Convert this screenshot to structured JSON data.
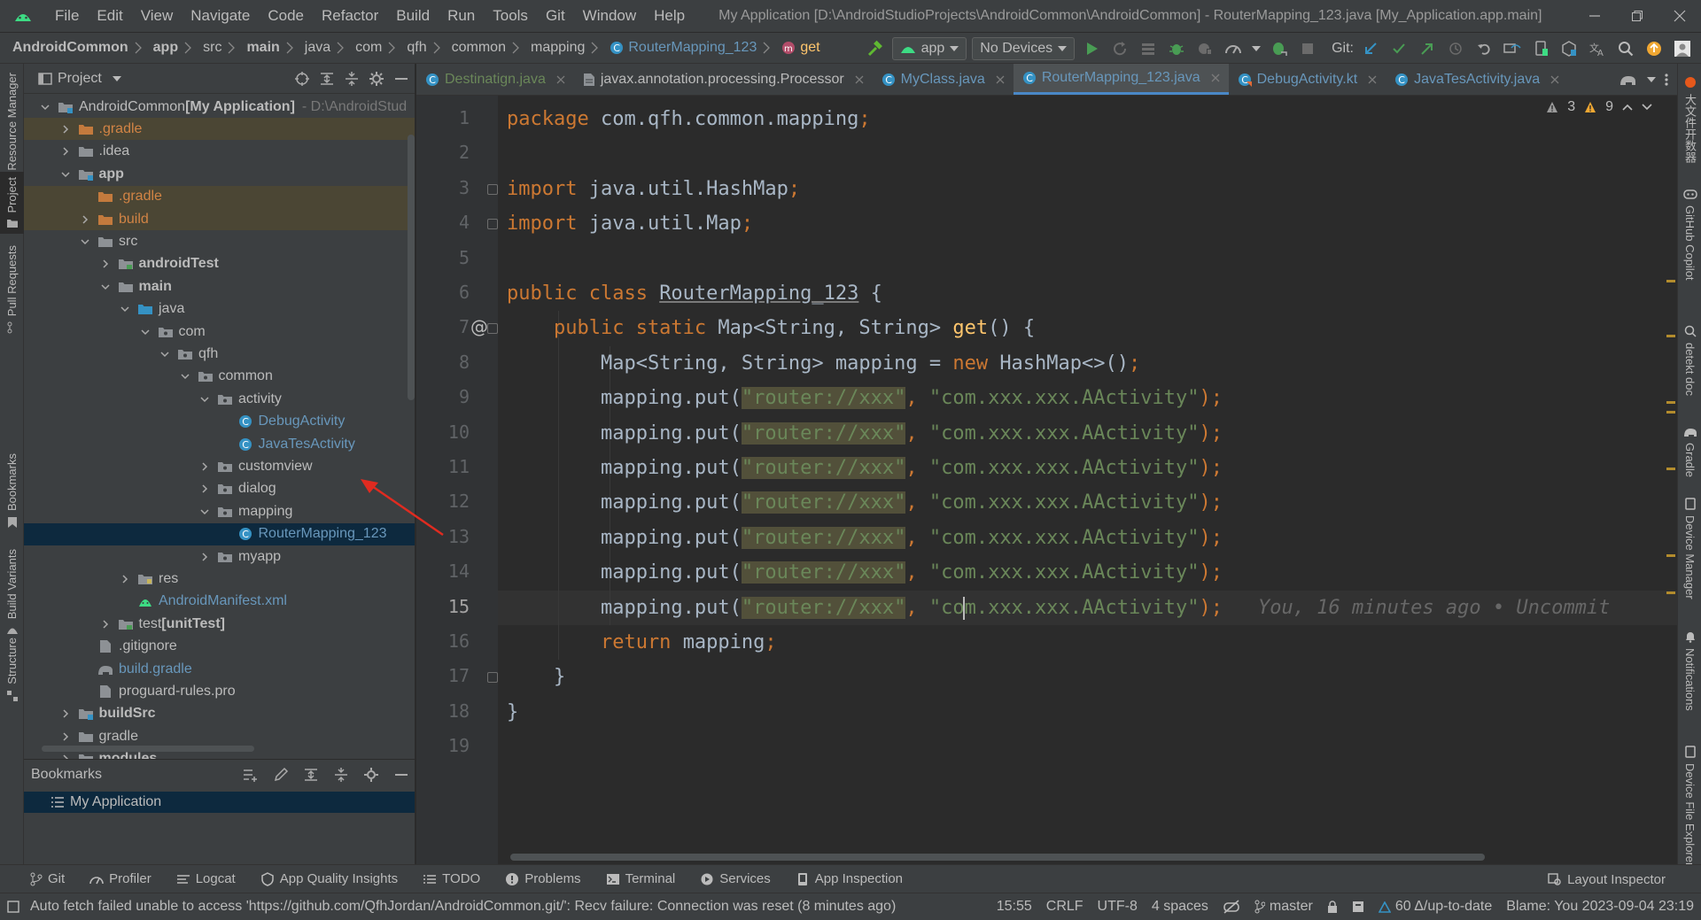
{
  "menu": [
    "File",
    "Edit",
    "View",
    "Navigate",
    "Code",
    "Refactor",
    "Build",
    "Run",
    "Tools",
    "Git",
    "Window",
    "Help"
  ],
  "window_title": "My Application [D:\\AndroidStudioProjects\\AndroidCommon\\AndroidCommon] - RouterMapping_123.java [My_Application.app.main]",
  "breadcrumbs": [
    "AndroidCommon",
    "app",
    "src",
    "main",
    "java",
    "com",
    "qfh",
    "common",
    "mapping",
    "RouterMapping_123",
    "get"
  ],
  "toolbar": {
    "run_config": "app",
    "device": "No Devices",
    "git_label": "Git:"
  },
  "left_strip": [
    "Resource Manager",
    "Project",
    "Pull Requests",
    "Bookmarks",
    "Build Variants",
    "Structure"
  ],
  "right_strip": [
    "大文件开数器",
    "GitHub Copilot",
    "detekt doc",
    "Gradle",
    "Device Manager",
    "Notifications",
    "Device File Explorer"
  ],
  "project": {
    "title": "Project",
    "tree": [
      {
        "label": "AndroidCommon",
        "suffix": " [My Application]",
        "path": " - D:\\AndroidStud",
        "depth": 0,
        "arrow": "down",
        "icon": "module",
        "style": "root"
      },
      {
        "label": ".gradle",
        "depth": 1,
        "arrow": "right",
        "icon": "folder-orange",
        "style": "orange",
        "excluded": true
      },
      {
        "label": ".idea",
        "depth": 1,
        "arrow": "right",
        "icon": "folder",
        "style": "plain"
      },
      {
        "label": "app",
        "depth": 1,
        "arrow": "down",
        "icon": "module",
        "style": "bold"
      },
      {
        "label": ".gradle",
        "depth": 2,
        "arrow": "",
        "icon": "folder-orange",
        "style": "orange",
        "excluded": true
      },
      {
        "label": "build",
        "depth": 2,
        "arrow": "right",
        "icon": "folder-orange",
        "style": "orange",
        "excluded": true
      },
      {
        "label": "src",
        "depth": 2,
        "arrow": "down",
        "icon": "folder",
        "style": "plain"
      },
      {
        "label": "androidTest",
        "depth": 3,
        "arrow": "right",
        "icon": "folder-test",
        "style": "bold"
      },
      {
        "label": "main",
        "depth": 3,
        "arrow": "down",
        "icon": "folder",
        "style": "bold"
      },
      {
        "label": "java",
        "depth": 4,
        "arrow": "down",
        "icon": "folder-src",
        "style": "plain"
      },
      {
        "label": "com",
        "depth": 5,
        "arrow": "down",
        "icon": "package",
        "style": "plain"
      },
      {
        "label": "qfh",
        "depth": 6,
        "arrow": "down",
        "icon": "package",
        "style": "plain"
      },
      {
        "label": "common",
        "depth": 7,
        "arrow": "down",
        "icon": "package",
        "style": "plain"
      },
      {
        "label": "activity",
        "depth": 8,
        "arrow": "down",
        "icon": "package",
        "style": "plain"
      },
      {
        "label": "DebugActivity",
        "depth": 9,
        "arrow": "",
        "icon": "class",
        "style": "blue"
      },
      {
        "label": "JavaTesActivity",
        "depth": 9,
        "arrow": "",
        "icon": "class",
        "style": "blue"
      },
      {
        "label": "customview",
        "depth": 8,
        "arrow": "right",
        "icon": "package",
        "style": "plain"
      },
      {
        "label": "dialog",
        "depth": 8,
        "arrow": "right",
        "icon": "package",
        "style": "plain"
      },
      {
        "label": "mapping",
        "depth": 8,
        "arrow": "down",
        "icon": "package",
        "style": "plain"
      },
      {
        "label": "RouterMapping_123",
        "depth": 9,
        "arrow": "",
        "icon": "class",
        "style": "blue",
        "selected": true
      },
      {
        "label": "myapp",
        "depth": 8,
        "arrow": "right",
        "icon": "package",
        "style": "plain"
      },
      {
        "label": "res",
        "depth": 4,
        "arrow": "right",
        "icon": "folder-res",
        "style": "plain"
      },
      {
        "label": "AndroidManifest.xml",
        "depth": 4,
        "arrow": "",
        "icon": "xml",
        "style": "blue"
      },
      {
        "label": "test",
        "suffix": " [unitTest]",
        "depth": 3,
        "arrow": "right",
        "icon": "folder-test",
        "style": "plain"
      },
      {
        "label": ".gitignore",
        "depth": 2,
        "arrow": "",
        "icon": "file",
        "style": "plain"
      },
      {
        "label": "build.gradle",
        "depth": 2,
        "arrow": "",
        "icon": "gradle",
        "style": "blue"
      },
      {
        "label": "proguard-rules.pro",
        "depth": 2,
        "arrow": "",
        "icon": "file",
        "style": "plain"
      },
      {
        "label": "buildSrc",
        "depth": 1,
        "arrow": "right",
        "icon": "module",
        "style": "bold"
      },
      {
        "label": "gradle",
        "depth": 1,
        "arrow": "right",
        "icon": "folder",
        "style": "plain"
      },
      {
        "label": "modules",
        "depth": 1,
        "arrow": "right",
        "icon": "folder",
        "style": "bold"
      }
    ]
  },
  "bookmarks": {
    "title": "Bookmarks",
    "item": "My Application"
  },
  "tabs": [
    {
      "label": "Destinatign.java",
      "icon": "java-class",
      "color": "#6a8759"
    },
    {
      "label": "javax.annotation.processing.Processor",
      "icon": "text-file",
      "color": "#bbbbbb"
    },
    {
      "label": "MyClass.java",
      "icon": "java-class",
      "color": "#6897bb"
    },
    {
      "label": "RouterMapping_123.java",
      "icon": "java-class",
      "color": "#6897bb",
      "active": true
    },
    {
      "label": "DebugActivity.kt",
      "icon": "kotlin-class",
      "color": "#6897bb"
    },
    {
      "label": "JavaTesActivity.java",
      "icon": "java-class",
      "color": "#6897bb"
    }
  ],
  "editor": {
    "inspections": {
      "warn_a": "3",
      "warn_b": "9"
    },
    "current_line": 15,
    "blame_inline": "You, 16 minutes ago • Uncommit",
    "line_numbers": [
      "1",
      "2",
      "3",
      "4",
      "5",
      "6",
      "7",
      "8",
      "9",
      "10",
      "11",
      "12",
      "13",
      "14",
      "15",
      "16",
      "17",
      "18",
      "19"
    ],
    "lines": [
      [
        {
          "t": "package ",
          "c": "kw"
        },
        {
          "t": "com.qfh.common.mapping",
          "c": ""
        },
        {
          "t": ";",
          "c": "kw"
        }
      ],
      [],
      [
        {
          "t": "import ",
          "c": "kw"
        },
        {
          "t": "java.util.HashMap",
          "c": ""
        },
        {
          "t": ";",
          "c": "kw"
        }
      ],
      [
        {
          "t": "import ",
          "c": "kw"
        },
        {
          "t": "java.util.Map",
          "c": ""
        },
        {
          "t": ";",
          "c": "kw"
        }
      ],
      [],
      [
        {
          "t": "public class ",
          "c": "kw"
        },
        {
          "t": "RouterMapping_123",
          "c": "cls-ul"
        },
        {
          "t": " {",
          "c": ""
        }
      ],
      [
        {
          "t": "    public static ",
          "c": "kw"
        },
        {
          "t": "Map<String, String> ",
          "c": ""
        },
        {
          "t": "get",
          "c": "fn"
        },
        {
          "t": "() {",
          "c": ""
        }
      ],
      [
        {
          "t": "        Map<String, String> mapping = ",
          "c": ""
        },
        {
          "t": "new ",
          "c": "kw"
        },
        {
          "t": "HashMap<>()",
          "c": ""
        },
        {
          "t": ";",
          "c": "kw"
        }
      ],
      [
        {
          "t": "        mapping.put(",
          "c": ""
        },
        {
          "t": "\"router://xxx\"",
          "c": "strhl"
        },
        {
          "t": ", ",
          "c": "kw"
        },
        {
          "t": "\"com.xxx.xxx.AActivity\"",
          "c": "str"
        },
        {
          "t": ");",
          "c": "kw"
        }
      ],
      [
        {
          "t": "        mapping.put(",
          "c": ""
        },
        {
          "t": "\"router://xxx\"",
          "c": "strhl"
        },
        {
          "t": ", ",
          "c": "kw"
        },
        {
          "t": "\"com.xxx.xxx.AActivity\"",
          "c": "str"
        },
        {
          "t": ");",
          "c": "kw"
        }
      ],
      [
        {
          "t": "        mapping.put(",
          "c": ""
        },
        {
          "t": "\"router://xxx\"",
          "c": "strhl"
        },
        {
          "t": ", ",
          "c": "kw"
        },
        {
          "t": "\"com.xxx.xxx.AActivity\"",
          "c": "str"
        },
        {
          "t": ");",
          "c": "kw"
        }
      ],
      [
        {
          "t": "        mapping.put(",
          "c": ""
        },
        {
          "t": "\"router://xxx\"",
          "c": "strhl"
        },
        {
          "t": ", ",
          "c": "kw"
        },
        {
          "t": "\"com.xxx.xxx.AActivity\"",
          "c": "str"
        },
        {
          "t": ");",
          "c": "kw"
        }
      ],
      [
        {
          "t": "        mapping.put(",
          "c": ""
        },
        {
          "t": "\"router://xxx\"",
          "c": "strhl"
        },
        {
          "t": ", ",
          "c": "kw"
        },
        {
          "t": "\"com.xxx.xxx.AActivity\"",
          "c": "str"
        },
        {
          "t": ");",
          "c": "kw"
        }
      ],
      [
        {
          "t": "        mapping.put(",
          "c": ""
        },
        {
          "t": "\"router://xxx\"",
          "c": "strhl"
        },
        {
          "t": ", ",
          "c": "kw"
        },
        {
          "t": "\"com.xxx.xxx.AActivity\"",
          "c": "str"
        },
        {
          "t": ");",
          "c": "kw"
        }
      ],
      [
        {
          "t": "        mapping.put(",
          "c": ""
        },
        {
          "t": "\"router://xxx\"",
          "c": "strhl"
        },
        {
          "t": ", ",
          "c": "kw"
        },
        {
          "t": "\"com.xxx.xxx.AActivity\"",
          "c": "str"
        },
        {
          "t": ");",
          "c": "kw"
        }
      ],
      [
        {
          "t": "        return ",
          "c": "kw"
        },
        {
          "t": "mapping",
          "c": ""
        },
        {
          "t": ";",
          "c": "kw"
        }
      ],
      [
        {
          "t": "    }",
          "c": ""
        }
      ],
      [
        {
          "t": "}",
          "c": ""
        }
      ],
      []
    ]
  },
  "bottom_tools": [
    {
      "label": "Git",
      "icon": "git-icon"
    },
    {
      "label": "Profiler",
      "icon": "profiler-icon"
    },
    {
      "label": "Logcat",
      "icon": "logcat-icon"
    },
    {
      "label": "App Quality Insights",
      "icon": "quality-icon"
    },
    {
      "label": "TODO",
      "icon": "todo-icon"
    },
    {
      "label": "Problems",
      "icon": "problems-icon"
    },
    {
      "label": "Terminal",
      "icon": "terminal-icon"
    },
    {
      "label": "Services",
      "icon": "services-icon"
    },
    {
      "label": "App Inspection",
      "icon": "app-inspection-icon"
    }
  ],
  "layout_inspector": "Layout Inspector",
  "status": {
    "message": "Auto fetch failed unable to access 'https://github.com/QfhJordan/AndroidCommon.git/': Recv failure: Connection was reset (8 minutes ago)",
    "position": "15:55",
    "line_sep": "CRLF",
    "encoding": "UTF-8",
    "indent": "4 spaces",
    "branch": "master",
    "updates": "60 Δ/up-to-date",
    "blame": "Blame: You 2023-09-04 23:19"
  }
}
